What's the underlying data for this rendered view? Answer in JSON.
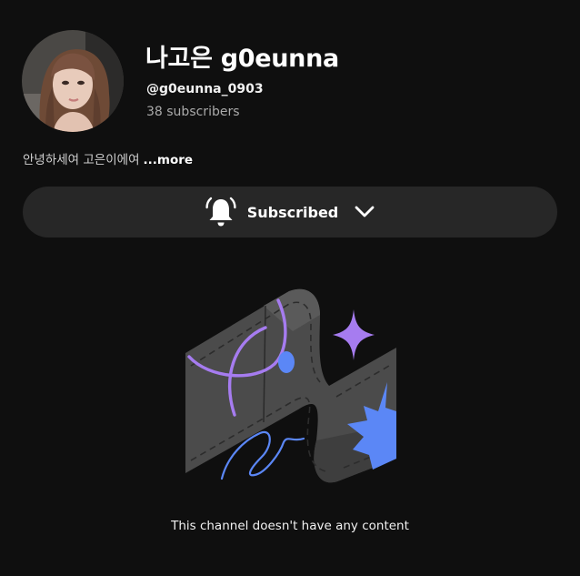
{
  "channel": {
    "name": "나고은 g0eunna",
    "handle": "@g0eunna_0903",
    "subscribers": "38 subscribers",
    "description": "안녕하세여 고은이에여",
    "more_label": "...more"
  },
  "subscribe_button": {
    "label": "Subscribed",
    "icon": "bell-icon",
    "dropdown_icon": "chevron-down-icon"
  },
  "empty_state": {
    "message": "This channel doesn't have any content",
    "illustration": "empty-channel-illustration"
  },
  "colors": {
    "background": "#0f0f0f",
    "button_background": "#272727",
    "text_primary": "#ffffff",
    "text_secondary": "#aaaaaa",
    "purple_accent": "#a67cf0",
    "blue_accent": "#5b87f6"
  }
}
